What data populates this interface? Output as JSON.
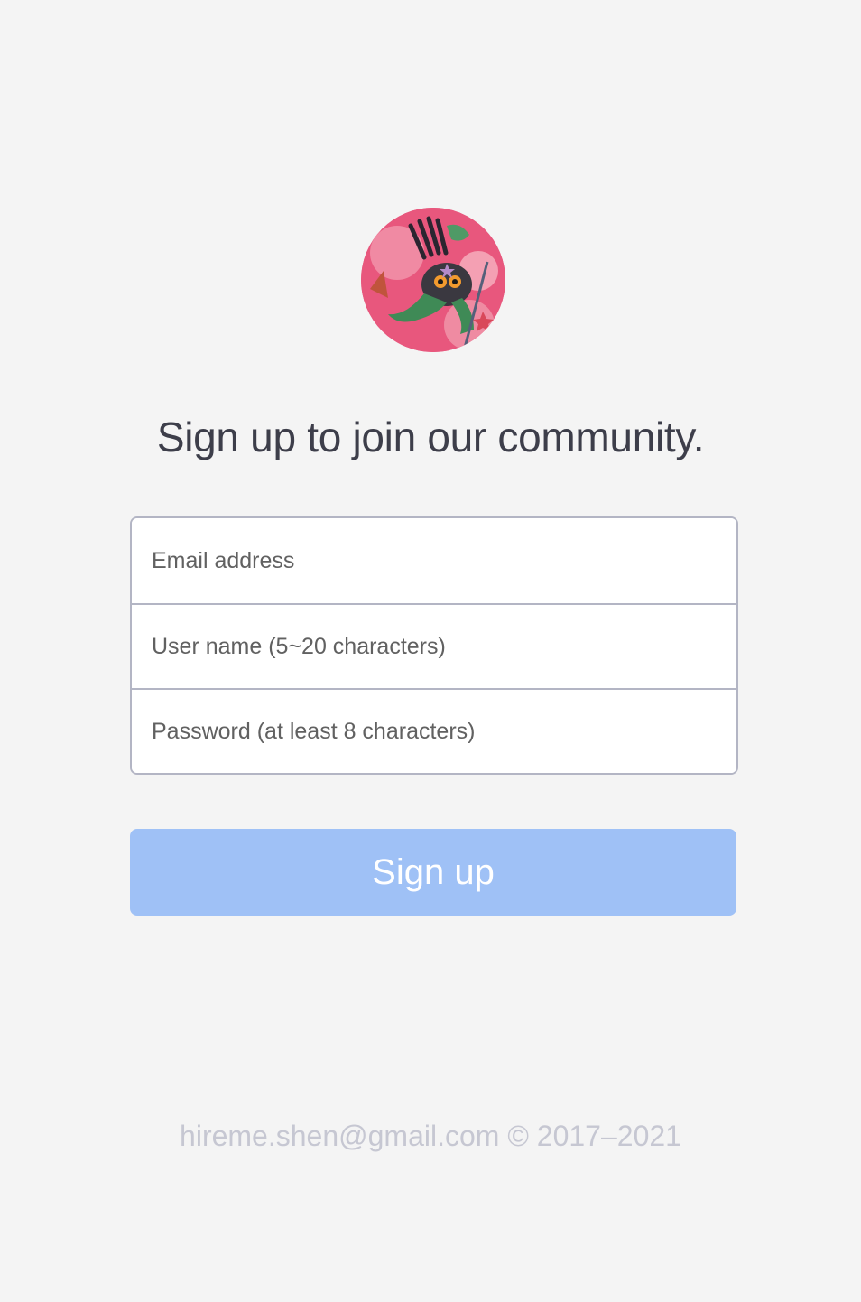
{
  "avatar": {
    "icon": "ninja-frog-avatar"
  },
  "header": {
    "title": "Sign up to join our community."
  },
  "form": {
    "email": {
      "placeholder": "Email address",
      "value": ""
    },
    "username": {
      "placeholder": "User name (5~20 characters)",
      "value": ""
    },
    "password": {
      "placeholder": "Password (at least 8 characters)",
      "value": ""
    }
  },
  "actions": {
    "signup_label": "Sign up"
  },
  "footer": {
    "email": "hireme.shen@gmail.com",
    "copyright": "© 2017–2021"
  },
  "colors": {
    "background": "#f4f4f4",
    "title": "#3d3e4a",
    "border": "#b3b5c4",
    "button": "#9fc1f6",
    "footer": "#c6c7d2"
  }
}
